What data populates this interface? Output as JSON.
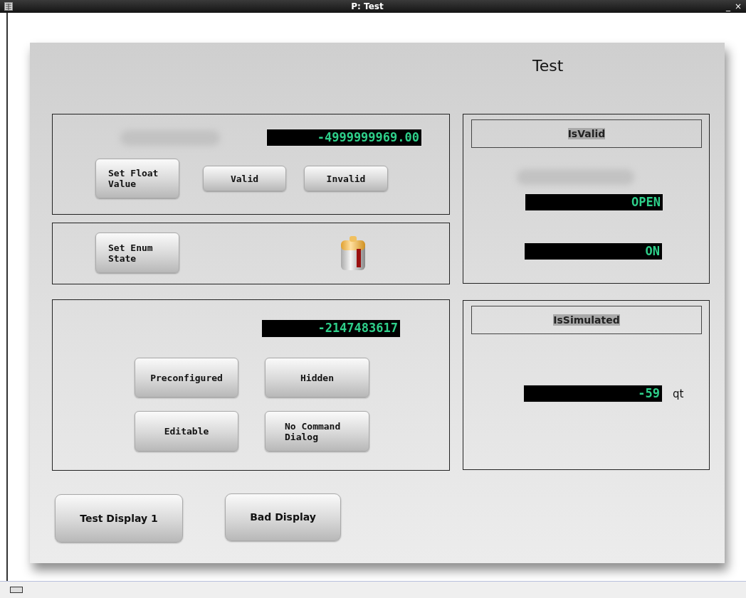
{
  "window": {
    "title": "P: Test",
    "controls": [
      "_",
      "×"
    ]
  },
  "display": {
    "title": "Test",
    "float_panel": {
      "readout": "-4999999969.00",
      "buttons": [
        "Set Float Value",
        "Valid",
        "Invalid"
      ]
    },
    "enum_panel": {
      "button": "Set Enum State"
    },
    "int_panel": {
      "readout": "-2147483617",
      "buttons": [
        "Preconfigured",
        "Hidden",
        "Editable",
        "No Command Dialog"
      ]
    },
    "valid_panel": {
      "header": "IsValid",
      "readouts": [
        "OPEN",
        "ON"
      ]
    },
    "simulated_panel": {
      "header": "IsSimulated",
      "readout": "-59",
      "unit": "qt"
    },
    "nav_buttons": [
      "Test Display 1",
      "Bad Display"
    ]
  }
}
